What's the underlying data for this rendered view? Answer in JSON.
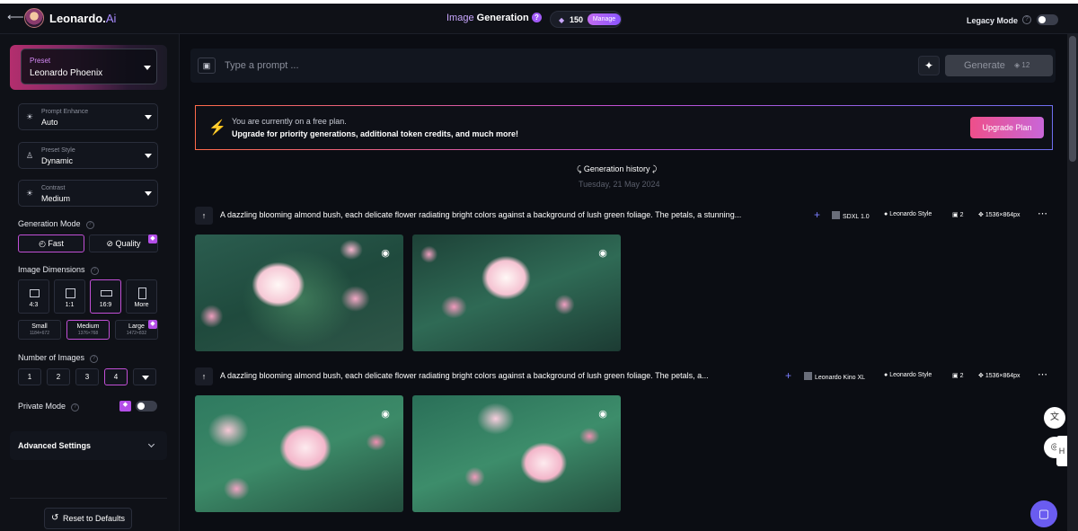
{
  "header": {
    "app_name": "Leonardo.",
    "app_suffix": "Ai",
    "mode_prefix": "Image",
    "mode_title": " Generation",
    "tokens": "150",
    "manage_label": "Manage",
    "legacy_mode_label": "Legacy Mode",
    "legacy_mode_on": false
  },
  "sidebar": {
    "preset": {
      "label": "Preset",
      "value": "Leonardo Phoenix"
    },
    "prompt_enhance": {
      "label": "Prompt Enhance",
      "value": "Auto"
    },
    "preset_style": {
      "label": "Preset Style",
      "value": "Dynamic"
    },
    "contrast": {
      "label": "Contrast",
      "value": "Medium"
    },
    "generation_mode": {
      "title": "Generation Mode",
      "options": [
        "Fast",
        "Quality"
      ],
      "selected": "Fast"
    },
    "image_dimensions": {
      "title": "Image Dimensions",
      "ratios": [
        "4:3",
        "1:1",
        "16:9",
        "More"
      ],
      "selected_ratio": "16:9",
      "sizes": [
        {
          "name": "Small",
          "dims": "1184×672"
        },
        {
          "name": "Medium",
          "dims": "1376×768"
        },
        {
          "name": "Large",
          "dims": "1472×832"
        }
      ],
      "selected_size": "Medium"
    },
    "number_of_images": {
      "title": "Number of Images",
      "options": [
        "1",
        "2",
        "3",
        "4"
      ],
      "selected": "4"
    },
    "private_mode": {
      "label": "Private Mode",
      "on": false
    },
    "advanced_settings": "Advanced Settings",
    "reset_label": "Reset to Defaults"
  },
  "prompt": {
    "placeholder": "Type a prompt ...",
    "generate_label": "Generate",
    "generate_cost": "12"
  },
  "banner": {
    "line1": "You are currently on a free plan.",
    "line2": "Upgrade for priority generations, additional token credits, and much more!",
    "button": "Upgrade Plan"
  },
  "history": {
    "title": "Generation history",
    "date": "Tuesday, 21 May 2024",
    "generations": [
      {
        "prompt": "A dazzling blooming almond bush, each delicate flower radiating bright colors against a background of lush green foliage. The petals, a stunning...",
        "model": "SDXL 1.0",
        "style": "Leonardo Style",
        "count": "2",
        "size": "1536×864px"
      },
      {
        "prompt": "A dazzling blooming almond bush, each delicate flower radiating bright colors against a background of lush green foliage. The petals, a...",
        "model": "Leonardo Kino XL",
        "style": "Leonardo Style",
        "count": "2",
        "size": "1536×864px"
      }
    ]
  },
  "colors": {
    "accent": "#c14fd6",
    "background": "#0b0d13",
    "upgrade_gradient_start": "#ee4f8a",
    "upgrade_gradient_end": "#c966d8"
  }
}
